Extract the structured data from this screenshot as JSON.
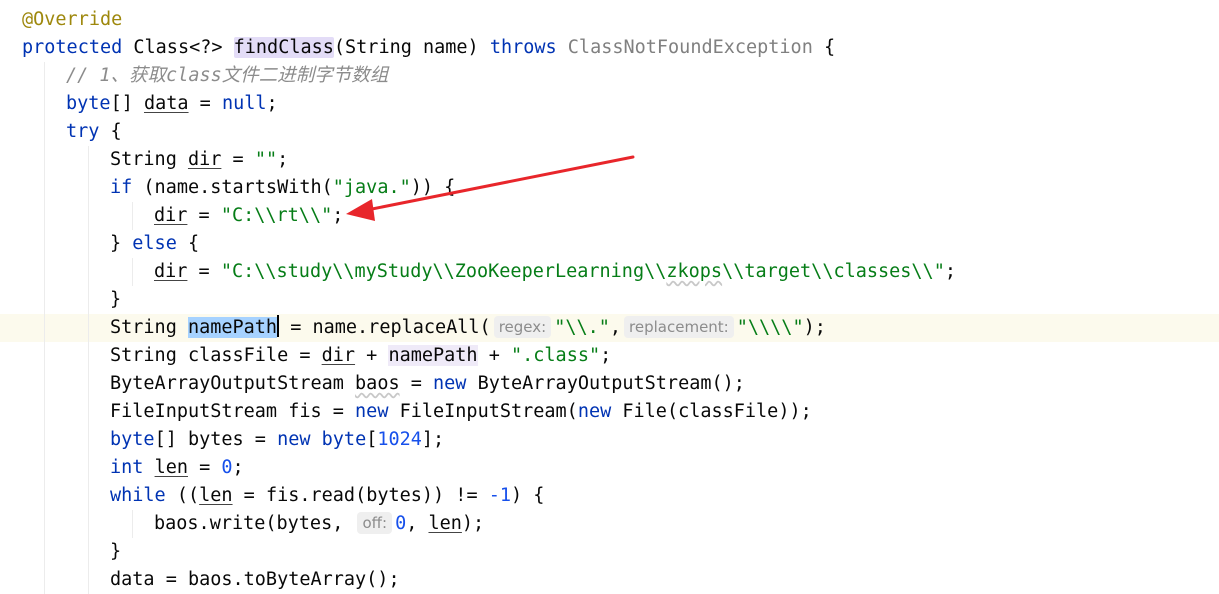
{
  "editor": {
    "l1": {
      "annotation": "@Override"
    },
    "l2": {
      "kw1": "protected",
      "t1": " Class<?> ",
      "method": "findClass",
      "t2": "(String name) ",
      "kw2": "throws",
      "t3": " ",
      "exc": "ClassNotFoundException",
      "t4": " {"
    },
    "l3": {
      "comment": "// 1、获取class文件二进制字节数组"
    },
    "l4": {
      "kw": "byte",
      "t1": "[] ",
      "var": "data",
      "t2": " = ",
      "kw2": "null",
      "t3": ";"
    },
    "l5": {
      "kw": "try",
      "t1": " {"
    },
    "l6": {
      "t1": "String ",
      "var": "dir",
      "t2": " = ",
      "str": "\"\"",
      "t3": ";"
    },
    "l7": {
      "kw": "if",
      "t1": " (name.startsWith(",
      "str": "\"java.\"",
      "t2": ")) {"
    },
    "l8": {
      "var": "dir",
      "t1": " = ",
      "str": "\"C:\\\\rt\\\\\"",
      "t2": ";"
    },
    "l9": {
      "t1": "} ",
      "kw": "else",
      "t2": " {"
    },
    "l10": {
      "var": "dir",
      "t1": " = ",
      "str1": "\"C:\\\\study\\\\myStudy\\\\ZooKeeperLearning\\\\",
      "str2": "zkops",
      "str3": "\\\\target\\\\classes\\\\\"",
      "t2": ";"
    },
    "l11": {
      "t1": "}"
    },
    "l12": {
      "t1": "String ",
      "var": "namePath",
      "t2": " = name.replaceAll(",
      "hint1": "regex:",
      "str1": "\"\\\\.\"",
      "t3": ",",
      "hint2": "replacement:",
      "str2": "\"\\\\\\\\\"",
      "t4": ");"
    },
    "l13": {
      "t1": "String classFile = ",
      "var1": "dir",
      "t2": " + ",
      "var2": "namePath",
      "t3": " + ",
      "str": "\".class\"",
      "t4": ";"
    },
    "l14": {
      "t1": "ByteArrayOutputStream ",
      "var": "baos",
      "t2": " = ",
      "kw": "new",
      "t3": " ByteArrayOutputStream();"
    },
    "l15": {
      "t1": "FileInputStream fis = ",
      "kw1": "new",
      "t2": " FileInputStream(",
      "kw2": "new",
      "t3": " File(classFile));"
    },
    "l16": {
      "kw1": "byte",
      "t1": "[] bytes = ",
      "kw2": "new",
      "t2": " ",
      "kw3": "byte",
      "t3": "[",
      "num": "1024",
      "t4": "];"
    },
    "l17": {
      "kw": "int",
      "t1": " ",
      "var": "len",
      "t2": " = ",
      "num": "0",
      "t3": ";"
    },
    "l18": {
      "kw": "while",
      "t1": " ((",
      "var": "len",
      "t2": " = fis.read(bytes)) != ",
      "num": "-1",
      "t3": ") {"
    },
    "l19": {
      "t1": "baos.write(bytes, ",
      "hint": "off:",
      "num": "0",
      "t2": ", ",
      "var": "len",
      "t3": ");"
    },
    "l20": {
      "t1": "}"
    },
    "l21": {
      "t1": "data = baos.toByteArray();"
    }
  },
  "colors": {
    "keyword": "#0033b3",
    "annotation": "#9e880d",
    "string": "#067d17",
    "number": "#1750eb",
    "comment": "#8c8c8c",
    "arrow": "#e8262b"
  },
  "overlay": {
    "arrow": "red-arrow-pointing-to-dir-rt"
  }
}
